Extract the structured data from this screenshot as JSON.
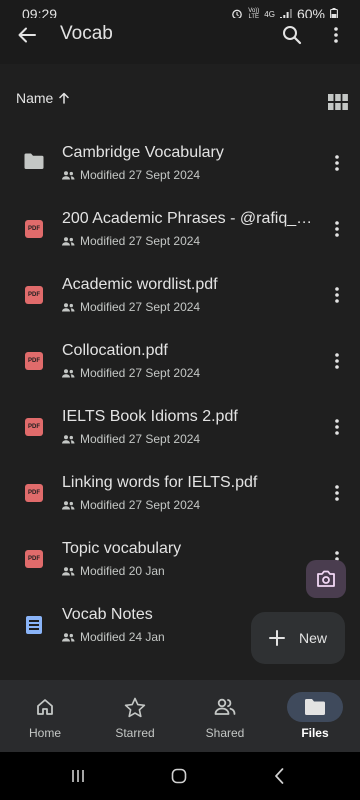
{
  "status": {
    "time": "09:29",
    "network_top": "Vo))",
    "network_bottom": "LTE",
    "network_type": "4G",
    "battery": "60%"
  },
  "app_bar": {
    "title": "Vocab",
    "back_icon": "arrow-back-icon",
    "search_icon": "search-icon",
    "more_icon": "more-vert-icon"
  },
  "sort": {
    "label": "Name",
    "direction_icon": "arrow-up-icon",
    "view_toggle_icon": "grid-view-icon"
  },
  "files": [
    {
      "name": "Cambridge Vocabulary",
      "modified": "Modified 27 Sept 2024",
      "type": "folder"
    },
    {
      "name": "200 Academic Phrases - @rafiq_al...",
      "modified": "Modified 27 Sept 2024",
      "type": "pdf"
    },
    {
      "name": "Academic wordlist.pdf",
      "modified": "Modified 27 Sept 2024",
      "type": "pdf"
    },
    {
      "name": "Collocation.pdf",
      "modified": "Modified 27 Sept 2024",
      "type": "pdf"
    },
    {
      "name": "IELTS Book Idioms 2.pdf",
      "modified": "Modified 27 Sept 2024",
      "type": "pdf"
    },
    {
      "name": "Linking words for IELTS.pdf",
      "modified": "Modified 27 Sept 2024",
      "type": "pdf"
    },
    {
      "name": "Topic vocabulary",
      "modified": "Modified 20 Jan",
      "type": "pdf"
    },
    {
      "name": "Vocab Notes",
      "modified": "Modified 24 Jan",
      "type": "doc"
    }
  ],
  "pdf_badge": "PDF",
  "fab": {
    "camera_icon": "camera-scan-icon",
    "new_label": "New"
  },
  "bottom_nav": [
    {
      "label": "Home",
      "icon": "home-icon",
      "active": false
    },
    {
      "label": "Starred",
      "icon": "star-icon",
      "active": false
    },
    {
      "label": "Shared",
      "icon": "shared-people-icon",
      "active": false
    },
    {
      "label": "Files",
      "icon": "folder-icon",
      "active": true
    }
  ],
  "colors": {
    "background": "#1f1f1f",
    "pdf_red": "#e06b6b",
    "doc_blue": "#8ab4f8",
    "active_pill": "#3f4a5c",
    "camera_fab": "#4a3d4f"
  }
}
